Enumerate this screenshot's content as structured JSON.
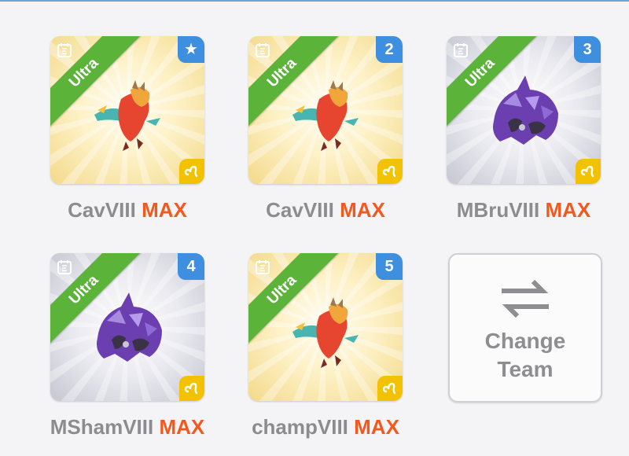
{
  "team": {
    "slots": [
      {
        "tier": "Ultra",
        "badge": "★",
        "name": "CavVIII",
        "level": "MAX",
        "creature": "fire-dragon",
        "bg": "gold"
      },
      {
        "tier": "Ultra",
        "badge": "2",
        "name": "CavVIII",
        "level": "MAX",
        "creature": "fire-dragon",
        "bg": "gold"
      },
      {
        "tier": "Ultra",
        "badge": "3",
        "name": "MBruVIII",
        "level": "MAX",
        "creature": "crystal-beast",
        "bg": "silver"
      },
      {
        "tier": "Ultra",
        "badge": "4",
        "name": "MShamVIII",
        "level": "MAX",
        "creature": "crystal-beast",
        "bg": "silver"
      },
      {
        "tier": "Ultra",
        "badge": "5",
        "name": "champVIII",
        "level": "MAX",
        "creature": "fire-dragon",
        "bg": "gold"
      }
    ],
    "change_button": {
      "line1": "Change",
      "line2": "Team"
    }
  },
  "colors": {
    "ultra_green": "#5bb33a",
    "badge_blue": "#3e8fe0",
    "max_orange": "#f05a1e",
    "zodiac_yellow": "#f2c200"
  },
  "icons": {
    "top_left": "notes-icon",
    "zodiac": "leo-icon",
    "swap": "swap-arrows-icon"
  }
}
